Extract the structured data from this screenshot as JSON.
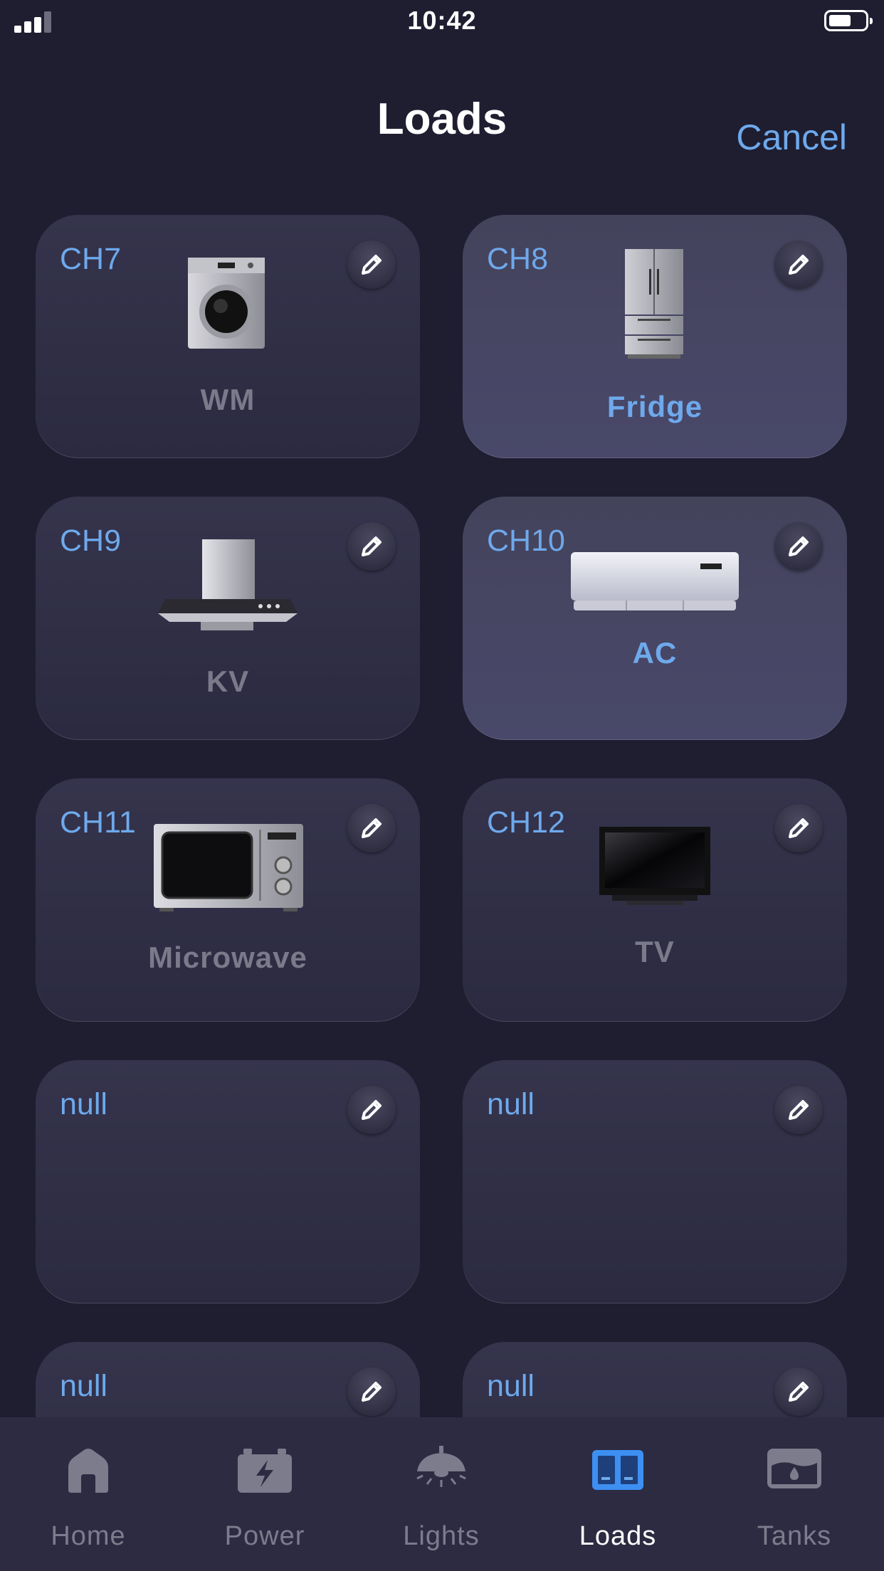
{
  "status_bar": {
    "time": "10:42",
    "signal_bars": 3
  },
  "header": {
    "title": "Loads",
    "cancel_label": "Cancel"
  },
  "loads": [
    {
      "channel": "CH7",
      "name": "WM",
      "icon": "washing-machine-icon",
      "active": false
    },
    {
      "channel": "CH8",
      "name": "Fridge",
      "icon": "fridge-icon",
      "active": true
    },
    {
      "channel": "CH9",
      "name": "KV",
      "icon": "kitchen-hood-icon",
      "active": false
    },
    {
      "channel": "CH10",
      "name": "AC",
      "icon": "air-conditioner-icon",
      "active": true
    },
    {
      "channel": "CH11",
      "name": "Microwave",
      "icon": "microwave-icon",
      "active": false
    },
    {
      "channel": "CH12",
      "name": "TV",
      "icon": "tv-icon",
      "active": false
    },
    {
      "channel": "null",
      "name": "",
      "icon": "",
      "active": false
    },
    {
      "channel": "null",
      "name": "",
      "icon": "",
      "active": false
    },
    {
      "channel": "null",
      "name": "",
      "icon": "",
      "active": false
    },
    {
      "channel": "null",
      "name": "",
      "icon": "",
      "active": false
    }
  ],
  "tabs": [
    {
      "label": "Home",
      "icon": "home-icon",
      "active": false
    },
    {
      "label": "Power",
      "icon": "battery-power-icon",
      "active": false
    },
    {
      "label": "Lights",
      "icon": "ceiling-light-icon",
      "active": false
    },
    {
      "label": "Loads",
      "icon": "loads-panel-icon",
      "active": true
    },
    {
      "label": "Tanks",
      "icon": "water-tank-icon",
      "active": false
    }
  ],
  "colors": {
    "accent": "#6ea9ec",
    "background": "#1f1e31",
    "card": "#2e2d44",
    "card_active": "#45445f",
    "inactive_text": "#7b7a8a"
  }
}
